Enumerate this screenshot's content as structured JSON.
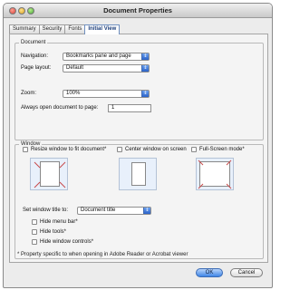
{
  "window": {
    "title": "Document Properties"
  },
  "tabs": [
    "Summary",
    "Security",
    "Fonts",
    "Initial View"
  ],
  "active_tab": "Initial View",
  "document": {
    "legend": "Document",
    "navigation_label": "Navigation:",
    "navigation_value": "Bookmarks pane and page",
    "page_layout_label": "Page layout:",
    "page_layout_value": "Default",
    "zoom_label": "Zoom:",
    "zoom_value": "100%",
    "open_page_label": "Always open document to page:",
    "open_page_value": "1"
  },
  "window_group": {
    "legend": "Window",
    "resize_label": "Resize window to fit document*",
    "center_label": "Center window on screen",
    "fullscreen_label": "Full-Screen mode*",
    "title_label": "Set window title to:",
    "title_value": "Document title",
    "hide_menu_label": "Hide menu bar*",
    "hide_tools_label": "Hide tools*",
    "hide_controls_label": "Hide window controls*",
    "footnote": "* Property specific to when opening in Adobe Reader or Acrobat viewer"
  },
  "buttons": {
    "ok": "OK",
    "cancel": "Cancel"
  },
  "colors": {
    "accent": "#3f86e6",
    "panel_bg": "#f4f4f4"
  },
  "icons": [
    "select-arrow-icon"
  ]
}
